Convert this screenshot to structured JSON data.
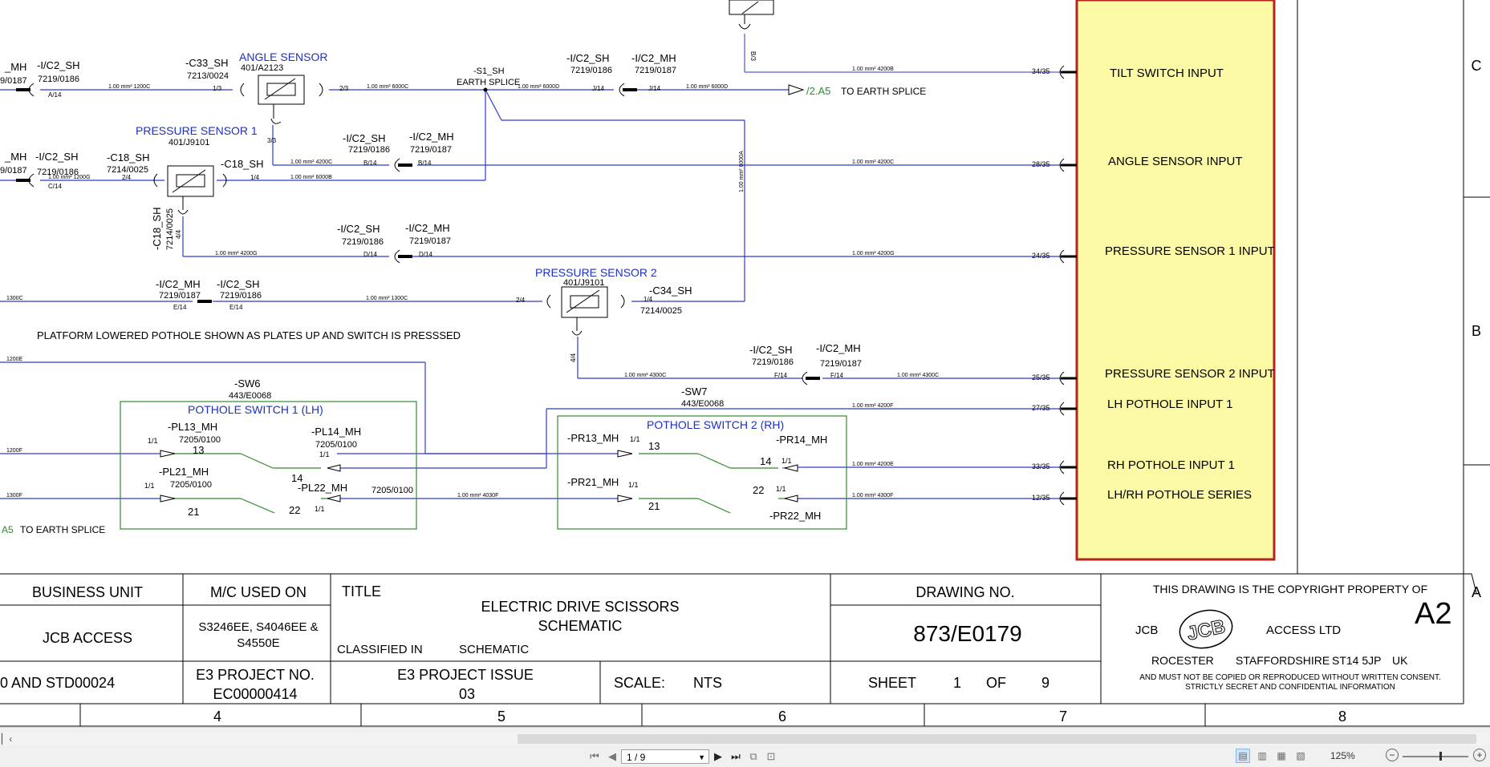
{
  "schematic": {
    "blue_labels": {
      "angle_sensor": "ANGLE SENSOR",
      "pressure_sensor_1": "PRESSURE SENSOR 1",
      "pressure_sensor_2": "PRESSURE SENSOR 2",
      "pothole_switch_1": "POTHOLE SWITCH 1 (LH)",
      "pothole_switch_2": "POTHOLE SWITCH 2 (RH)"
    },
    "ecu_inputs": [
      "TILT SWITCH INPUT",
      "ANGLE SENSOR INPUT",
      "PRESSURE SENSOR 1 INPUT",
      "PRESSURE SENSOR 2 INPUT",
      "LH POTHOLE INPUT 1",
      "RH POTHOLE INPUT 1",
      "LH/RH POTHOLE SERIES"
    ],
    "ecu_pins": [
      "34/35",
      "28/35",
      "24/35",
      "25/35",
      "27/35",
      "33/35",
      "12/35"
    ],
    "note": "PLATFORM LOWERED POTHOLE SHOWN AS PLATES UP AND SWITCH IS PRESSSED",
    "earth_splice": {
      "s1": "-S1_SH",
      "label": "EARTH SPLICE",
      "ref": "/2.A5",
      "to": "TO EARTH SPLICE",
      "ref_left": "A5"
    },
    "connectors": {
      "ic2sh": "-I/C2_SH",
      "ic2mh": "-I/C2_MH",
      "mh": "_MH",
      "mh_num": "7219/0187",
      "sh_num": "7219/0186",
      "c33": "-C33_SH",
      "c33_num": "7213/0024",
      "as_num": "401/A2123",
      "c18": "-C18_SH",
      "c18_num": "7214/0025",
      "ps_num": "401/J9101",
      "c34": "-C34_SH",
      "c34_num": "7214/0025",
      "sw6": "-SW6",
      "sw6_num": "443/E0068",
      "sw7": "-SW7",
      "sw7_num": "443/E0068",
      "pl13": "-PL13_MH",
      "pl13_num": "7205/0100",
      "pl14": "-PL14_MH",
      "pl14_num": "7205/0100",
      "pl21": "-PL21_MH",
      "pl21_num": "7205/0100",
      "pl22": "-PL22_MH",
      "pl22_num": "7205/0100",
      "pr13": "-PR13_MH",
      "pr14": "-PR14_MH",
      "pr21": "-PR21_MH",
      "pr22": "-PR22_MH"
    },
    "pins": {
      "n13": "13",
      "n14": "14",
      "n21": "21",
      "n22": "22",
      "p11": "1/1",
      "a14": "A/14",
      "c14": "C/14",
      "b14": "B/14",
      "d14": "D/14",
      "e14": "E/14",
      "f14": "F/14",
      "j14": "J/14",
      "p13": "1/3",
      "p23": "2/3",
      "p33": "3/3",
      "p14": "1/4",
      "p24": "2/4",
      "p44": "4/4",
      "b3": "B/3",
      "v0187": "9/0187",
      "v14": "14"
    },
    "wires": {
      "w1200C": "1.00 mm² 1200C",
      "w6000C": "1.00 mm² 6000C",
      "w6000D": "1.00 mm² 6000D",
      "w4200B": "1.00 mm² 4200B",
      "w4200C": "1.00 mm² 4200C",
      "w6000B": "1.00 mm² 6000B",
      "w1200G": "1.00 mm² 1200G",
      "w6000A": "1.00 mm² 6000A",
      "w4200G": "1.00 mm² 4200G",
      "w1300C": "1300C",
      "w1300C_full": "1.00 mm² 1300C",
      "w4300C": "1.00 mm² 4300C",
      "w4200F": "1.00 mm² 4200F",
      "w1200E": "1200E",
      "w1200F": "1200F",
      "w1300F": "1300F",
      "w4200E": "1.00 mm² 4200E",
      "w4030F": "1.00 mm² 4030F",
      "w4300F": "1.00 mm² 4300F"
    },
    "border_rows": [
      "C",
      "B",
      "A"
    ],
    "border_cols": [
      "4",
      "5",
      "6",
      "7",
      "8"
    ]
  },
  "title_block": {
    "business_unit_label": "BUSINESS UNIT",
    "business_unit": "JCB ACCESS",
    "mc_label": "M/C USED ON",
    "mc_line1": "S3246EE, S4046EE &",
    "mc_line2": "S4550E",
    "title_label": "TITLE",
    "title_line1": "ELECTRIC DRIVE SCISSORS",
    "title_line2": "SCHEMATIC",
    "classified_label": "CLASSIFIED IN",
    "classified_value": "SCHEMATIC",
    "drawing_label": "DRAWING NO.",
    "drawing_no": "873/E0179",
    "copyright_line": "THIS DRAWING IS THE COPYRIGHT PROPERTY OF",
    "company_left": "JCB",
    "company_right": "ACCESS LTD",
    "logo_text": "JCB",
    "sheet_size": "A2",
    "address": [
      "ROCESTER",
      "STAFFORDSHIRE",
      "ST14 5JP",
      "UK"
    ],
    "legal_line1": "AND MUST NOT BE COPIED OR REPRODUCED WITHOUT WRITTEN CONSENT.",
    "legal_line2": "STRICTLY SECRET AND CONFIDENTIAL INFORMATION",
    "std_text": "0 AND STD00024",
    "e3_no_label": "E3 PROJECT NO.",
    "e3_no": "EC00000414",
    "e3_issue_label": "E3 PROJECT ISSUE",
    "e3_issue": "03",
    "scale_label": "SCALE:",
    "scale": "NTS",
    "sheet_label": "SHEET",
    "sheet_num": "1",
    "of_label": "OF",
    "sheet_total": "9"
  },
  "viewer": {
    "page_indicator": "1 / 9",
    "zoom": "125%",
    "colors": {
      "wire_blue": "#2d3bd1",
      "label_blue": "#1d2fc4",
      "switch_green": "#2e8b2e",
      "ecu_fill": "#fdfaa6",
      "ecu_border": "#b4251e"
    }
  }
}
